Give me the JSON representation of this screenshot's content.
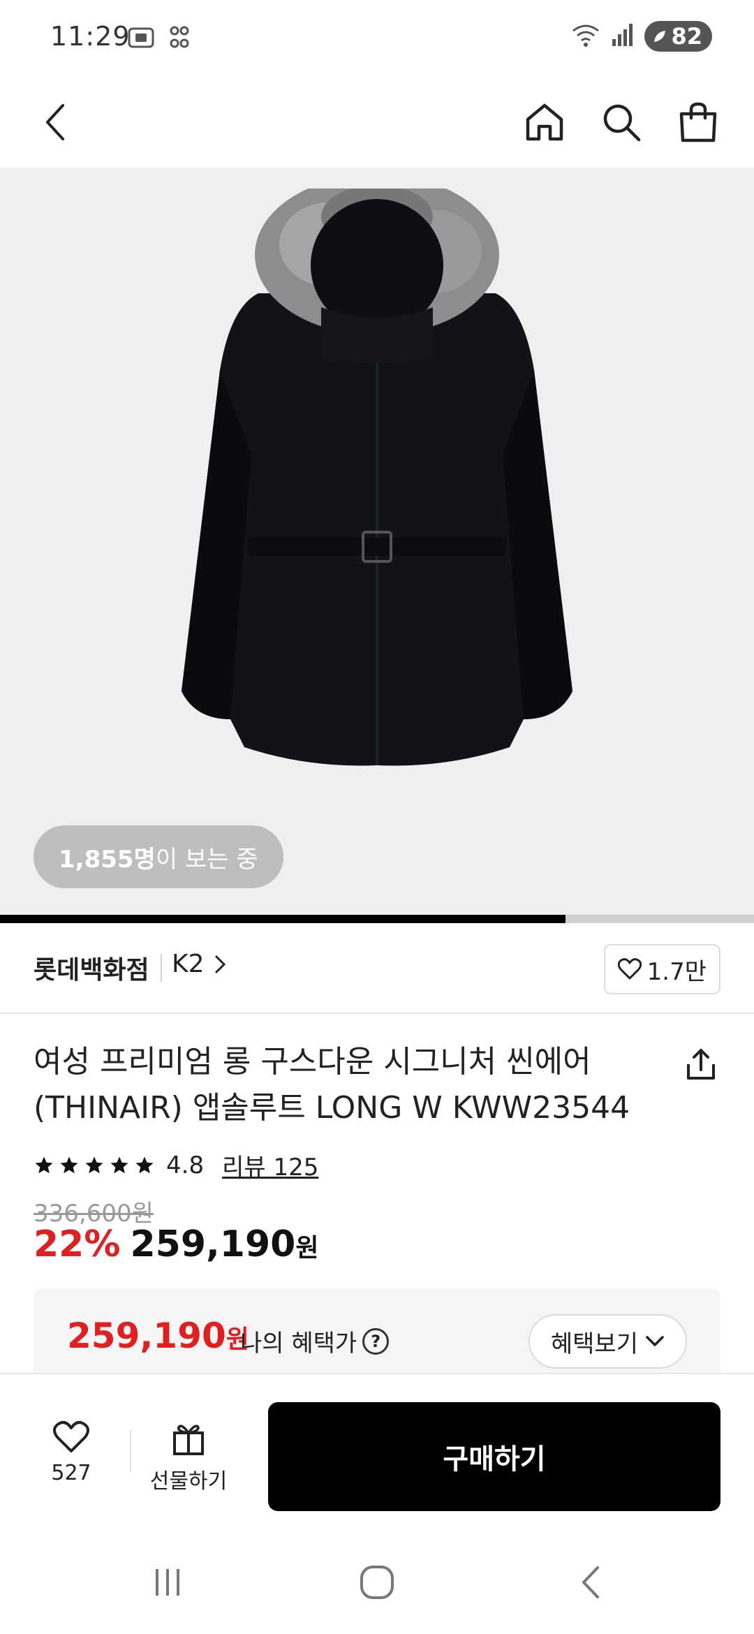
{
  "status_bar": {
    "time": "11:29",
    "battery": "82",
    "icons": [
      "screenshot-icon",
      "app-grid-icon",
      "wifi-icon",
      "signal-icon",
      "battery-icon"
    ]
  },
  "top_nav": {
    "icons": [
      "back-icon",
      "home-icon",
      "search-icon",
      "shopping-bag-icon"
    ]
  },
  "hero": {
    "viewers_count": "1,855명",
    "viewers_suffix": "이 보는 중",
    "progress": 0.75
  },
  "seller": {
    "store": "롯데백화점",
    "brand": "K2",
    "likes": "1.7만"
  },
  "product": {
    "title": "여성 프리미엄 롱 구스다운 시그니처 씬에어 (THINAIR) 앱솔루트 LONG W KWW23544",
    "rating": "4.8",
    "rating_stars": 5,
    "reviews": "리뷰 125",
    "original_price": "336,600원",
    "discount": "22%",
    "sale_price": "259,190",
    "currency": "원"
  },
  "benefit": {
    "price": "259,190",
    "currency": "원",
    "label": "나의 혜택가",
    "button": "혜택보기"
  },
  "action_bar": {
    "wish_count": "527",
    "gift_label": "선물하기",
    "buy_label": "구매하기"
  },
  "colors": {
    "accent_red": "#e02020",
    "buy_button": "#000000"
  }
}
